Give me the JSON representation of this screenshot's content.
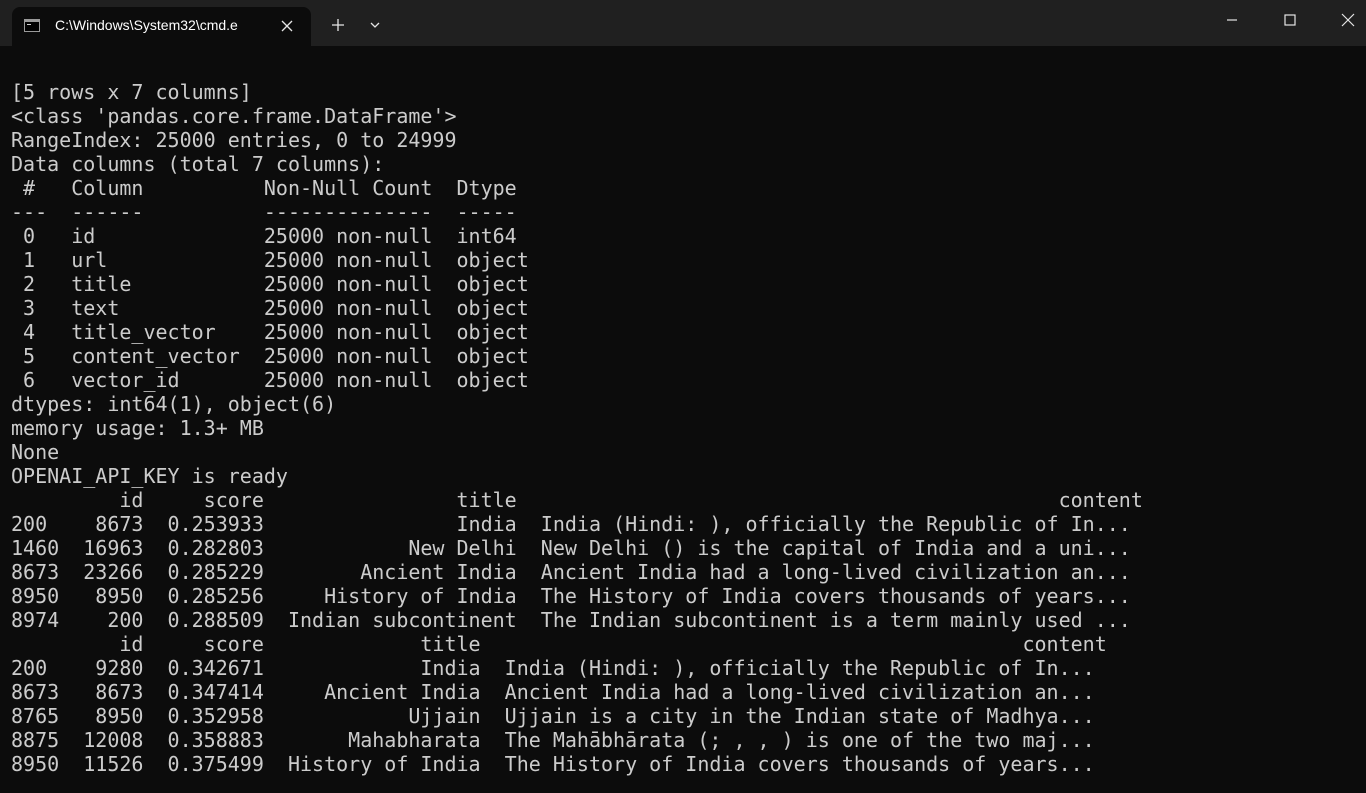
{
  "window": {
    "tab_title": "C:\\Windows\\System32\\cmd.e",
    "icons": {
      "tab": "terminal-icon",
      "close_tab": "close-icon",
      "new_tab": "plus-icon",
      "dropdown": "chevron-down-icon",
      "minimize": "minimize-icon",
      "maximize": "maximize-icon",
      "close_window": "close-icon"
    }
  },
  "console": {
    "lines": [
      "[5 rows x 7 columns]",
      "<class 'pandas.core.frame.DataFrame'>",
      "RangeIndex: 25000 entries, 0 to 24999",
      "Data columns (total 7 columns):",
      " #   Column          Non-Null Count  Dtype",
      "---  ------          --------------  -----",
      " 0   id              25000 non-null  int64",
      " 1   url             25000 non-null  object",
      " 2   title           25000 non-null  object",
      " 3   text            25000 non-null  object",
      " 4   title_vector    25000 non-null  object",
      " 5   content_vector  25000 non-null  object",
      " 6   vector_id       25000 non-null  object",
      "dtypes: int64(1), object(6)",
      "memory usage: 1.3+ MB",
      "None",
      "OPENAI_API_KEY is ready",
      "         id     score                title                                             content",
      "200    8673  0.253933                India  India (Hindi: ), officially the Republic of In...",
      "1460  16963  0.282803            New Delhi  New Delhi () is the capital of India and a uni...",
      "8673  23266  0.285229        Ancient India  Ancient India had a long-lived civilization an...",
      "8950   8950  0.285256     History of India  The History of India covers thousands of years...",
      "8974    200  0.288509  Indian subcontinent  The Indian subcontinent is a term mainly used ...",
      "         id     score             title                                             content",
      "200    9280  0.342671             India  India (Hindi: ), officially the Republic of In...",
      "8673   8673  0.347414     Ancient India  Ancient India had a long-lived civilization an...",
      "8765   8950  0.352958            Ujjain  Ujjain is a city in the Indian state of Madhya...",
      "8875  12008  0.358883       Mahabharata  The Mahābhārata (; , , ) is one of the two maj...",
      "8950  11526  0.375499  History of India  The History of India covers thousands of years..."
    ]
  }
}
